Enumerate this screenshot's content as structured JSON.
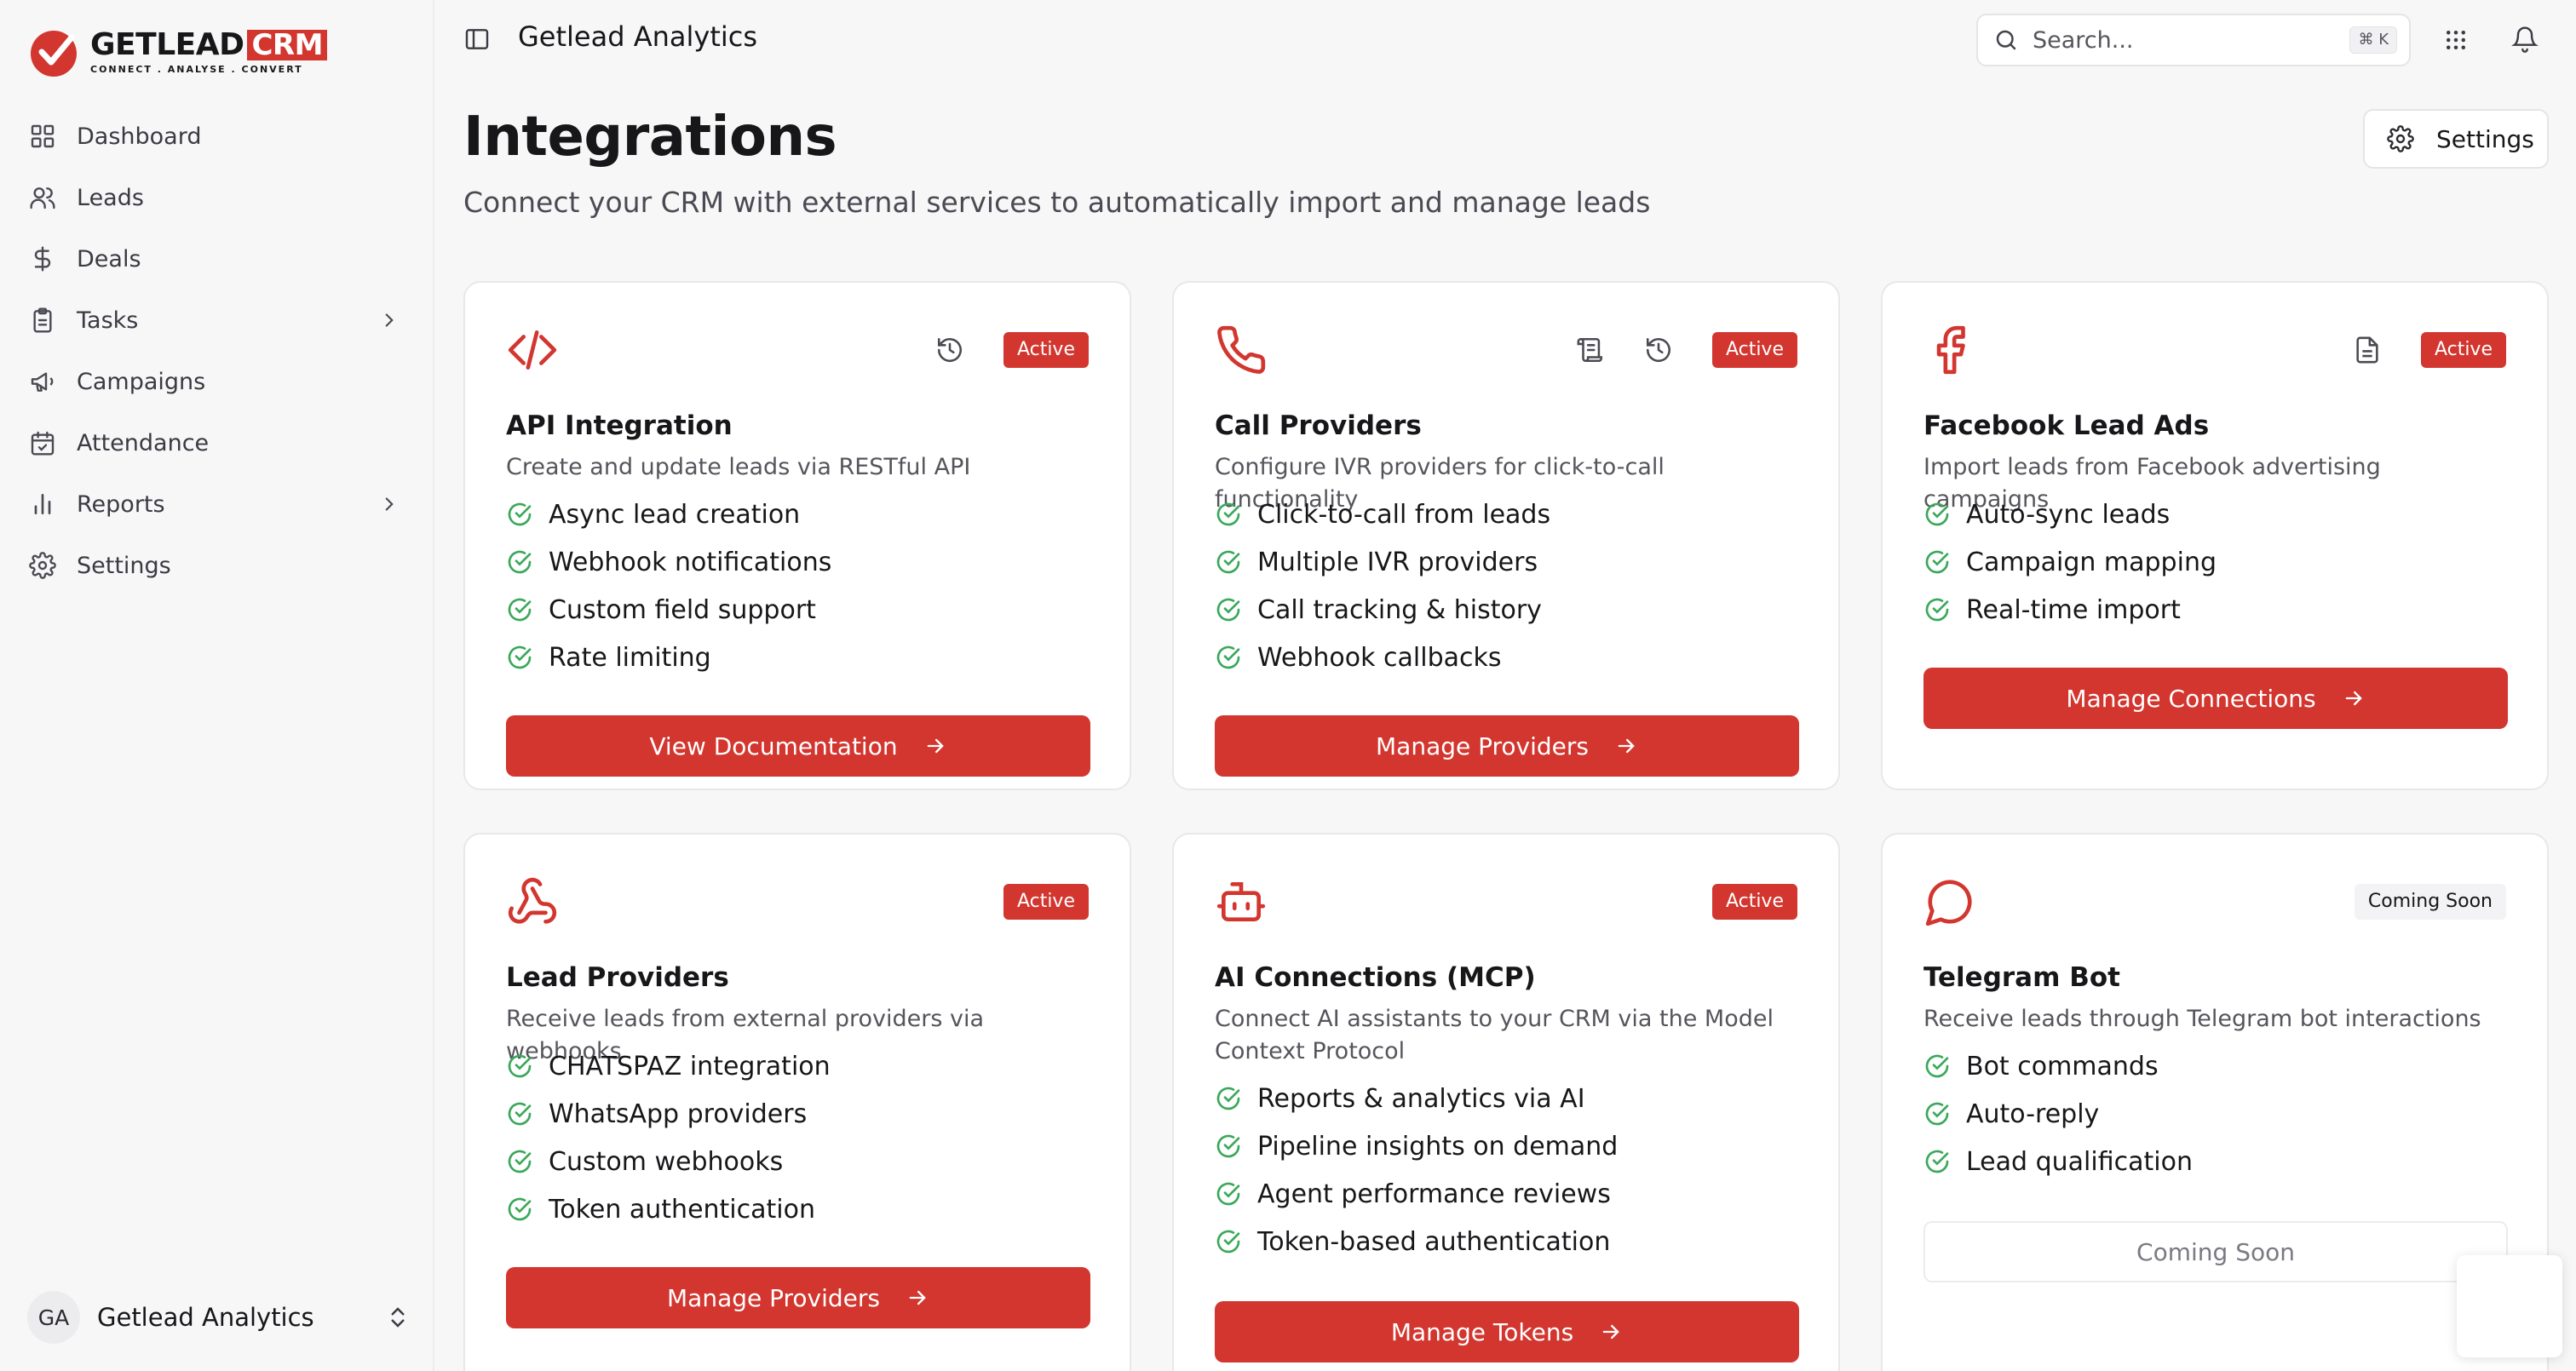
{
  "brand": {
    "word": "GETLEAD",
    "crm": "CRM",
    "tagline": "CONNECT  .  ANALYSE  .  CONVERT",
    "accent": "#d2362f"
  },
  "sidebar": {
    "items": [
      {
        "label": "Dashboard",
        "icon": "dashboard-icon"
      },
      {
        "label": "Leads",
        "icon": "users-icon"
      },
      {
        "label": "Deals",
        "icon": "dollar-icon"
      },
      {
        "label": "Tasks",
        "icon": "clipboard-icon"
      },
      {
        "label": "Campaigns",
        "icon": "megaphone-icon"
      },
      {
        "label": "Attendance",
        "icon": "calendar-check-icon"
      },
      {
        "label": "Reports",
        "icon": "bar-chart-icon"
      },
      {
        "label": "Settings",
        "icon": "gear-icon"
      }
    ],
    "user": {
      "initials": "GA",
      "name": "Getlead Analytics"
    }
  },
  "header": {
    "title": "Getlead Analytics",
    "search": {
      "placeholder": "Search...",
      "shortcut": "⌘ K"
    }
  },
  "page": {
    "title": "Integrations",
    "subtitle": "Connect your CRM with external services to automatically import and manage leads",
    "settings_label": "Settings"
  },
  "cards": [
    {
      "title": "API Integration",
      "description": "Create and update leads via RESTful API",
      "badge": "Active",
      "features": [
        "Async lead creation",
        "Webhook notifications",
        "Custom field support",
        "Rate limiting"
      ],
      "button": "View Documentation"
    },
    {
      "title": "Call Providers",
      "description": "Configure IVR providers for click-to-call functionality",
      "badge": "Active",
      "features": [
        "Click-to-call from leads",
        "Multiple IVR providers",
        "Call tracking & history",
        "Webhook callbacks"
      ],
      "button": "Manage Providers"
    },
    {
      "title": "Facebook Lead Ads",
      "description": "Import leads from Facebook advertising campaigns",
      "badge": "Active",
      "features": [
        "Auto-sync leads",
        "Campaign mapping",
        "Real-time import"
      ],
      "button": "Manage Connections"
    },
    {
      "title": "Lead Providers",
      "description": "Receive leads from external providers via webhooks",
      "badge": "Active",
      "features": [
        "CHATSPAZ integration",
        "WhatsApp providers",
        "Custom webhooks",
        "Token authentication"
      ],
      "button": "Manage Providers"
    },
    {
      "title": "AI Connections (MCP)",
      "description": "Connect AI assistants to your CRM via the Model Context Protocol",
      "badge": "Active",
      "features": [
        "Reports & analytics via AI",
        "Pipeline insights on demand",
        "Agent performance reviews",
        "Token-based authentication"
      ],
      "button": "Manage Tokens"
    },
    {
      "title": "Telegram Bot",
      "description": "Receive leads through Telegram bot interactions",
      "badge": "Coming Soon",
      "features": [
        "Bot commands",
        "Auto-reply",
        "Lead qualification"
      ],
      "button": "Coming Soon"
    }
  ]
}
